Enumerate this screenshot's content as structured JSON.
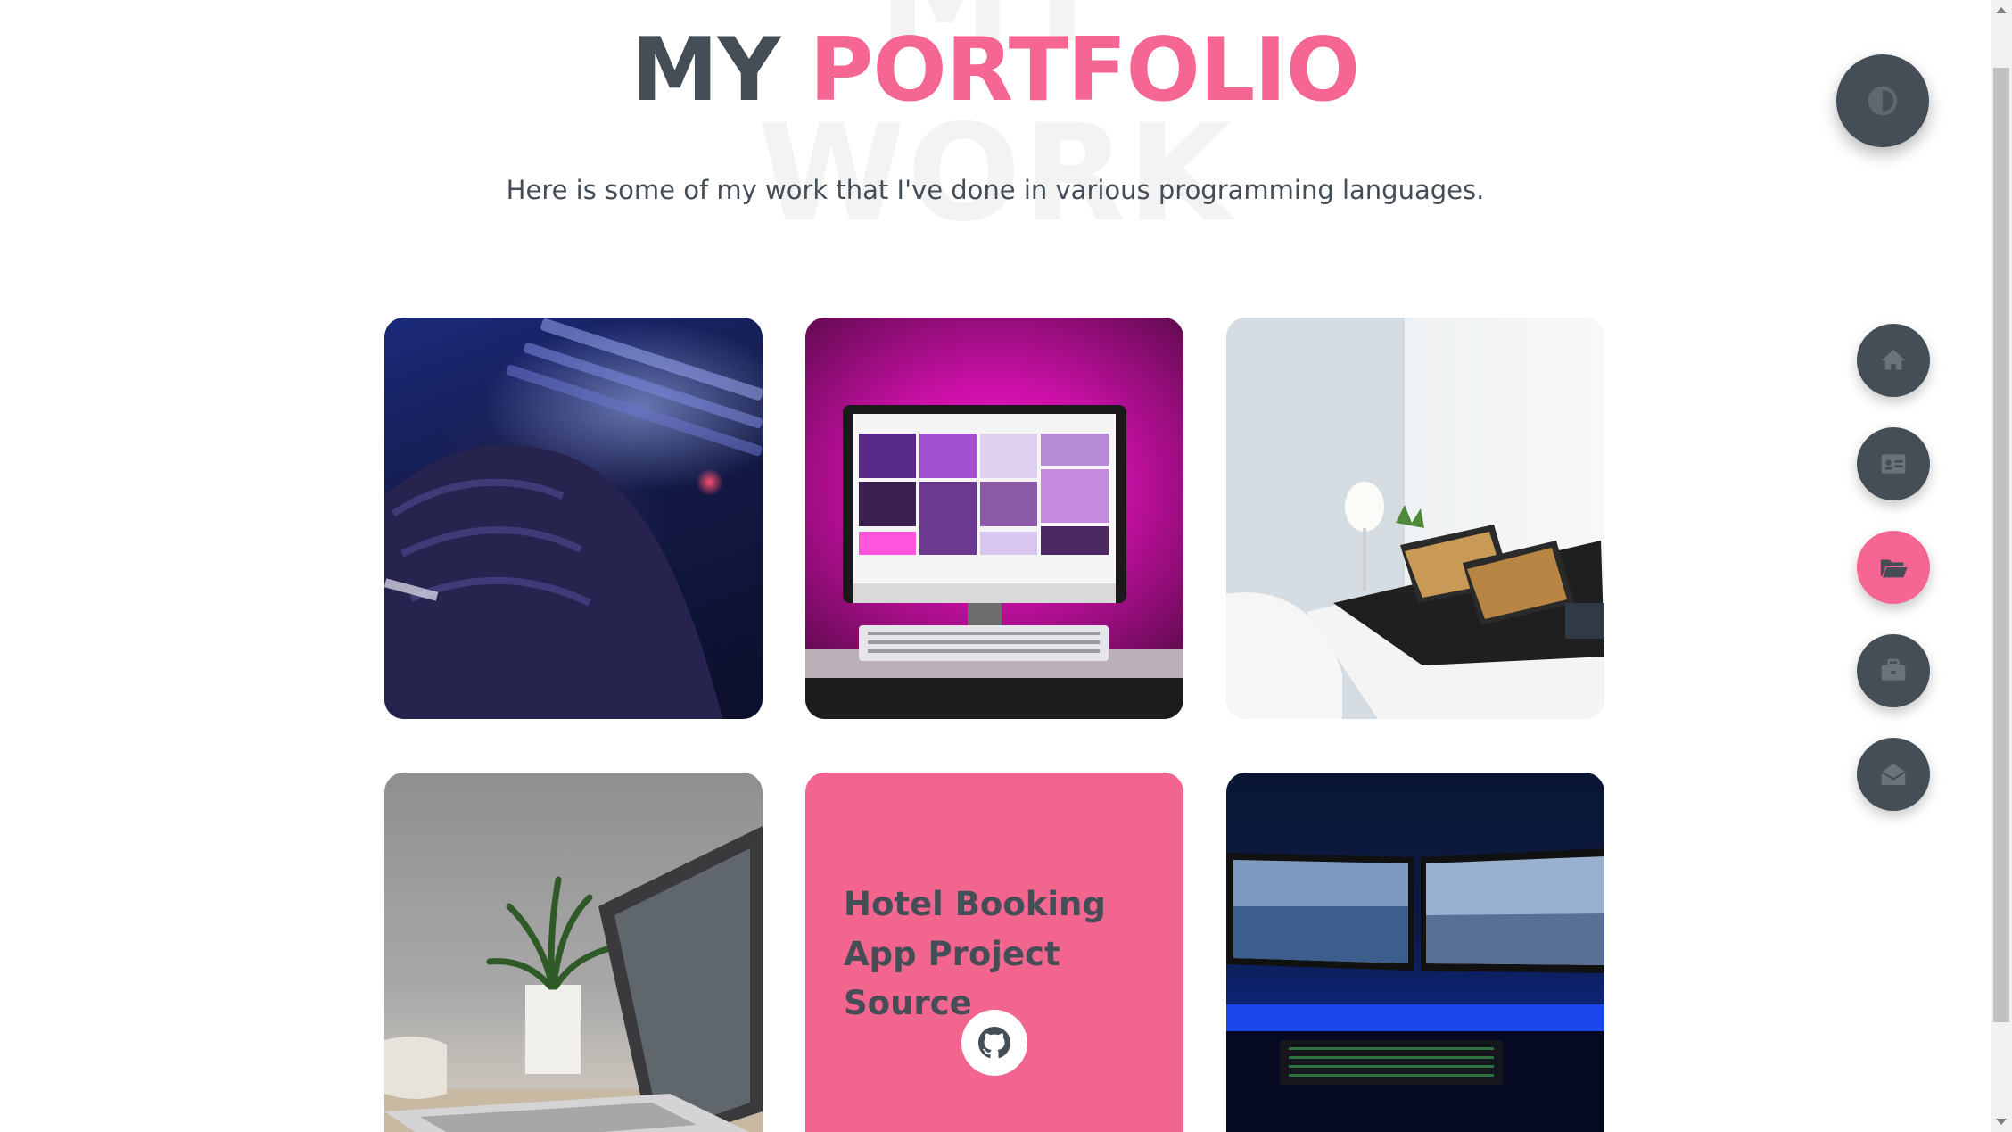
{
  "heading": {
    "watermark_line1": "MY",
    "watermark_line2": "WORK",
    "title_part1": "MY",
    "title_part2": "PORTFOLIO",
    "subtitle": "Here is some of my work that I've done in various programming languages."
  },
  "portfolio": {
    "items": [
      {
        "image": "hand-on-keyboard-photo"
      },
      {
        "image": "magenta-desk-imac-photo"
      },
      {
        "image": "white-desk-laptops-photo"
      },
      {
        "image": "laptop-and-plant-photo"
      },
      {
        "project_title": "Hotel Booking App Project Source",
        "link_icon": "github-icon"
      },
      {
        "image": "dual-monitor-setup-photo"
      }
    ]
  },
  "controls": {
    "theme_toggle_icon": "contrast-icon",
    "nav": [
      {
        "icon": "home-icon",
        "active": false
      },
      {
        "icon": "id-card-icon",
        "active": false
      },
      {
        "icon": "folder-open-icon",
        "active": true
      },
      {
        "icon": "briefcase-icon",
        "active": false
      },
      {
        "icon": "envelope-open-icon",
        "active": false
      }
    ]
  },
  "colors": {
    "accent": "#f56692",
    "dark": "#454e56",
    "background": "#ffffff"
  }
}
